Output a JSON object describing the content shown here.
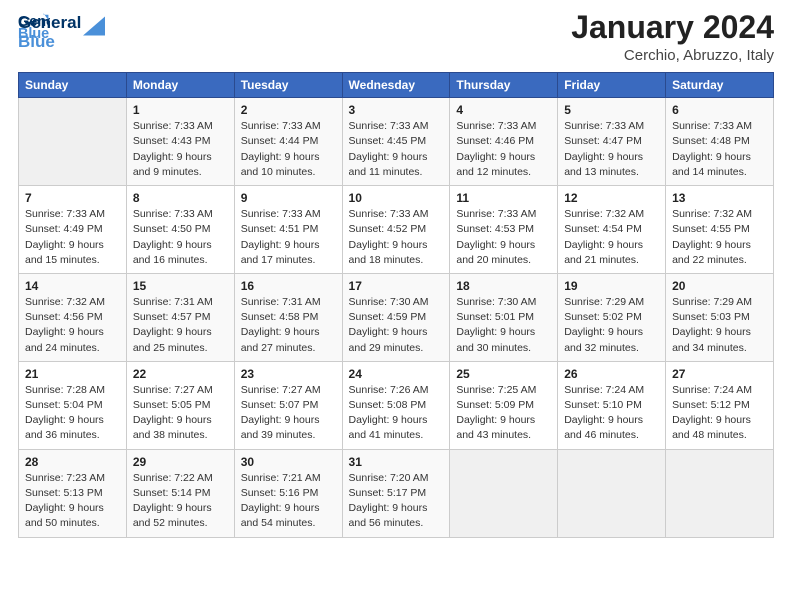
{
  "header": {
    "logo_line1": "General",
    "logo_line2": "Blue",
    "title": "January 2024",
    "subtitle": "Cerchio, Abruzzo, Italy"
  },
  "weekdays": [
    "Sunday",
    "Monday",
    "Tuesday",
    "Wednesday",
    "Thursday",
    "Friday",
    "Saturday"
  ],
  "weeks": [
    [
      {
        "day": "",
        "info": ""
      },
      {
        "day": "1",
        "info": "Sunrise: 7:33 AM\nSunset: 4:43 PM\nDaylight: 9 hours\nand 9 minutes."
      },
      {
        "day": "2",
        "info": "Sunrise: 7:33 AM\nSunset: 4:44 PM\nDaylight: 9 hours\nand 10 minutes."
      },
      {
        "day": "3",
        "info": "Sunrise: 7:33 AM\nSunset: 4:45 PM\nDaylight: 9 hours\nand 11 minutes."
      },
      {
        "day": "4",
        "info": "Sunrise: 7:33 AM\nSunset: 4:46 PM\nDaylight: 9 hours\nand 12 minutes."
      },
      {
        "day": "5",
        "info": "Sunrise: 7:33 AM\nSunset: 4:47 PM\nDaylight: 9 hours\nand 13 minutes."
      },
      {
        "day": "6",
        "info": "Sunrise: 7:33 AM\nSunset: 4:48 PM\nDaylight: 9 hours\nand 14 minutes."
      }
    ],
    [
      {
        "day": "7",
        "info": "Sunrise: 7:33 AM\nSunset: 4:49 PM\nDaylight: 9 hours\nand 15 minutes."
      },
      {
        "day": "8",
        "info": "Sunrise: 7:33 AM\nSunset: 4:50 PM\nDaylight: 9 hours\nand 16 minutes."
      },
      {
        "day": "9",
        "info": "Sunrise: 7:33 AM\nSunset: 4:51 PM\nDaylight: 9 hours\nand 17 minutes."
      },
      {
        "day": "10",
        "info": "Sunrise: 7:33 AM\nSunset: 4:52 PM\nDaylight: 9 hours\nand 18 minutes."
      },
      {
        "day": "11",
        "info": "Sunrise: 7:33 AM\nSunset: 4:53 PM\nDaylight: 9 hours\nand 20 minutes."
      },
      {
        "day": "12",
        "info": "Sunrise: 7:32 AM\nSunset: 4:54 PM\nDaylight: 9 hours\nand 21 minutes."
      },
      {
        "day": "13",
        "info": "Sunrise: 7:32 AM\nSunset: 4:55 PM\nDaylight: 9 hours\nand 22 minutes."
      }
    ],
    [
      {
        "day": "14",
        "info": "Sunrise: 7:32 AM\nSunset: 4:56 PM\nDaylight: 9 hours\nand 24 minutes."
      },
      {
        "day": "15",
        "info": "Sunrise: 7:31 AM\nSunset: 4:57 PM\nDaylight: 9 hours\nand 25 minutes."
      },
      {
        "day": "16",
        "info": "Sunrise: 7:31 AM\nSunset: 4:58 PM\nDaylight: 9 hours\nand 27 minutes."
      },
      {
        "day": "17",
        "info": "Sunrise: 7:30 AM\nSunset: 4:59 PM\nDaylight: 9 hours\nand 29 minutes."
      },
      {
        "day": "18",
        "info": "Sunrise: 7:30 AM\nSunset: 5:01 PM\nDaylight: 9 hours\nand 30 minutes."
      },
      {
        "day": "19",
        "info": "Sunrise: 7:29 AM\nSunset: 5:02 PM\nDaylight: 9 hours\nand 32 minutes."
      },
      {
        "day": "20",
        "info": "Sunrise: 7:29 AM\nSunset: 5:03 PM\nDaylight: 9 hours\nand 34 minutes."
      }
    ],
    [
      {
        "day": "21",
        "info": "Sunrise: 7:28 AM\nSunset: 5:04 PM\nDaylight: 9 hours\nand 36 minutes."
      },
      {
        "day": "22",
        "info": "Sunrise: 7:27 AM\nSunset: 5:05 PM\nDaylight: 9 hours\nand 38 minutes."
      },
      {
        "day": "23",
        "info": "Sunrise: 7:27 AM\nSunset: 5:07 PM\nDaylight: 9 hours\nand 39 minutes."
      },
      {
        "day": "24",
        "info": "Sunrise: 7:26 AM\nSunset: 5:08 PM\nDaylight: 9 hours\nand 41 minutes."
      },
      {
        "day": "25",
        "info": "Sunrise: 7:25 AM\nSunset: 5:09 PM\nDaylight: 9 hours\nand 43 minutes."
      },
      {
        "day": "26",
        "info": "Sunrise: 7:24 AM\nSunset: 5:10 PM\nDaylight: 9 hours\nand 46 minutes."
      },
      {
        "day": "27",
        "info": "Sunrise: 7:24 AM\nSunset: 5:12 PM\nDaylight: 9 hours\nand 48 minutes."
      }
    ],
    [
      {
        "day": "28",
        "info": "Sunrise: 7:23 AM\nSunset: 5:13 PM\nDaylight: 9 hours\nand 50 minutes."
      },
      {
        "day": "29",
        "info": "Sunrise: 7:22 AM\nSunset: 5:14 PM\nDaylight: 9 hours\nand 52 minutes."
      },
      {
        "day": "30",
        "info": "Sunrise: 7:21 AM\nSunset: 5:16 PM\nDaylight: 9 hours\nand 54 minutes."
      },
      {
        "day": "31",
        "info": "Sunrise: 7:20 AM\nSunset: 5:17 PM\nDaylight: 9 hours\nand 56 minutes."
      },
      {
        "day": "",
        "info": ""
      },
      {
        "day": "",
        "info": ""
      },
      {
        "day": "",
        "info": ""
      }
    ]
  ]
}
